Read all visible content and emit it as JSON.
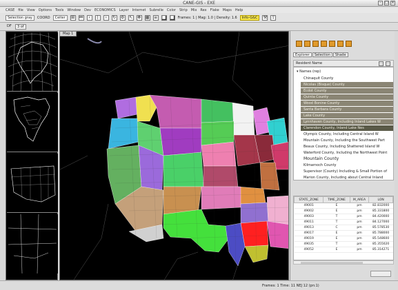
{
  "window": {
    "title": "CANE-GIS - EXE"
  },
  "menubar": {
    "items": [
      "CASE",
      "file",
      "View",
      "Options",
      "Tools",
      "Window",
      "Dev",
      "ECONOMICS",
      "Layer",
      "Internet",
      "Subrelle",
      "Color",
      "Strip",
      "Mix",
      "Rex",
      "Flake",
      "Maps",
      "Help"
    ],
    "highlight": "Info-G&C"
  },
  "toolbar": {
    "display_label": "Selection gray",
    "coord_label": "COORD",
    "coord_value": "Ceiter",
    "scale_text": "Frames: 1 | Mag: 1.0 | Density: 1.6"
  },
  "tabs": {
    "left_label": "DF",
    "active_label": "3 of"
  },
  "map": {
    "tab_label": "Map 1"
  },
  "right_panel": {
    "tabs": [
      "Explorer",
      "Selection",
      "Shade"
    ],
    "tree_header": "Resident Name",
    "tree_root": "Names (rep)",
    "items": [
      {
        "label": "Chinaquit County",
        "style": "normal"
      },
      {
        "label": "Nicolas (Bisque) County",
        "style": "hl"
      },
      {
        "label": "Ecdot County",
        "style": "hl"
      },
      {
        "label": "Quinta County",
        "style": "hl"
      },
      {
        "label": "Wood Bonine County",
        "style": "hl"
      },
      {
        "label": "Santa Barbara County",
        "style": "hl"
      },
      {
        "label": "Lake County",
        "style": "hl"
      },
      {
        "label": "Lynnhaven County, Including Inland Lakes W",
        "style": "hl"
      },
      {
        "label": "Clarendon County, Inland Lake Nes",
        "style": "hl2"
      },
      {
        "label": "Olympic County, Including Central Island W",
        "style": "normal"
      },
      {
        "label": "Mountain County, Including the Southwest Part",
        "style": "normal"
      },
      {
        "label": "Beaux County, Including Shattered Island W",
        "style": "normal"
      },
      {
        "label": "Waterford County, Including the Northwest Point",
        "style": "normal"
      },
      {
        "label": "Mountain County",
        "style": "big"
      },
      {
        "label": "Kilmarnoch County",
        "style": "normal"
      },
      {
        "label": "Supervisor (County) Including & Small Portion of",
        "style": "normal"
      },
      {
        "label": "Marion County, Including about Central Inland",
        "style": "normal"
      }
    ],
    "table": {
      "headers": [
        "STATE_ZONE",
        "TIME_ZONE",
        "M_AREA",
        "LON"
      ],
      "rows": [
        [
          "49001",
          "E",
          "pm",
          "82.832000"
        ],
        [
          "49002",
          "E",
          "pm",
          "85.331800"
        ],
        [
          "49003",
          "T",
          "pm",
          "84.420000"
        ],
        [
          "49011",
          "T",
          "pm",
          "84.127000"
        ],
        [
          "49013",
          "C",
          "pm",
          "85.578530"
        ],
        [
          "49017",
          "E",
          "pm",
          "85.788000"
        ],
        [
          "49019",
          "E",
          "pm",
          "85.548600"
        ],
        [
          "49035",
          "T",
          "pm",
          "85.355020"
        ],
        [
          "49052",
          "E",
          "pm",
          "85.314271"
        ]
      ]
    }
  },
  "status": {
    "text": "Frames: 1 Time: 11 NEJ 12 (pn:1)"
  }
}
